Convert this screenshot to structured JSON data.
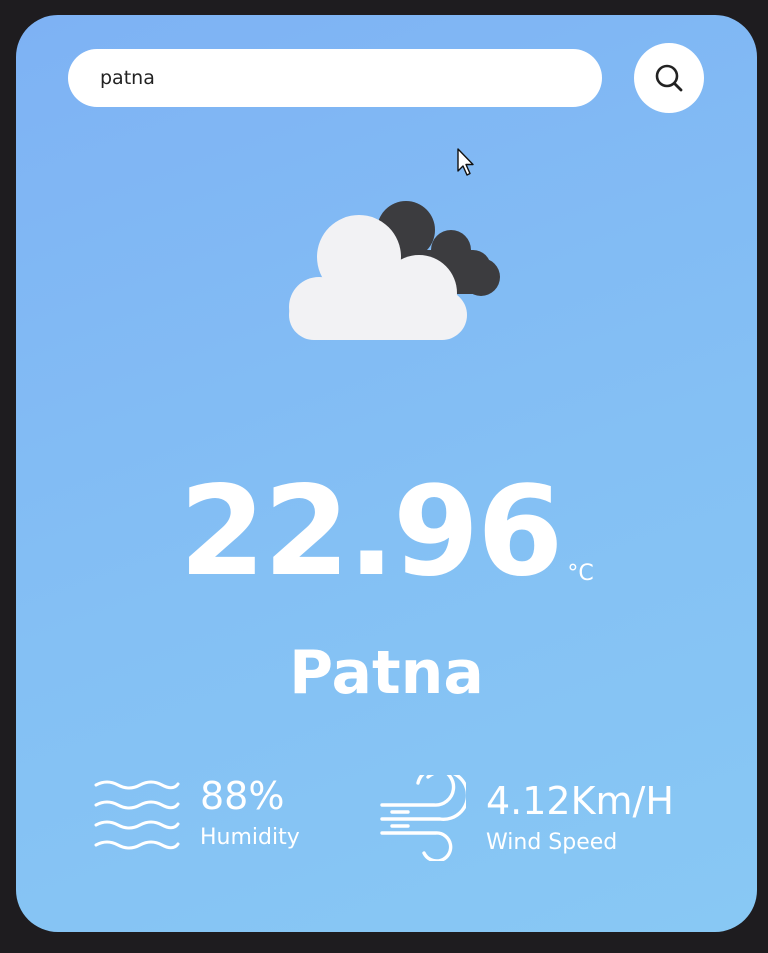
{
  "search": {
    "value": "patna",
    "icon": "search-icon"
  },
  "weather": {
    "icon": "cloud-icon",
    "temperature": "22.96",
    "unit": "°C",
    "city": "Patna"
  },
  "humidity": {
    "value": "88%",
    "label": "Humidity",
    "icon": "humidity-waves-icon"
  },
  "wind": {
    "value": "4.12Km/H",
    "label": "Wind Speed",
    "icon": "wind-icon"
  },
  "colors": {
    "card_top": "#7eb2f4",
    "card_bottom": "#88c8f4",
    "background": "#1e1c1f",
    "text": "#ffffff"
  }
}
